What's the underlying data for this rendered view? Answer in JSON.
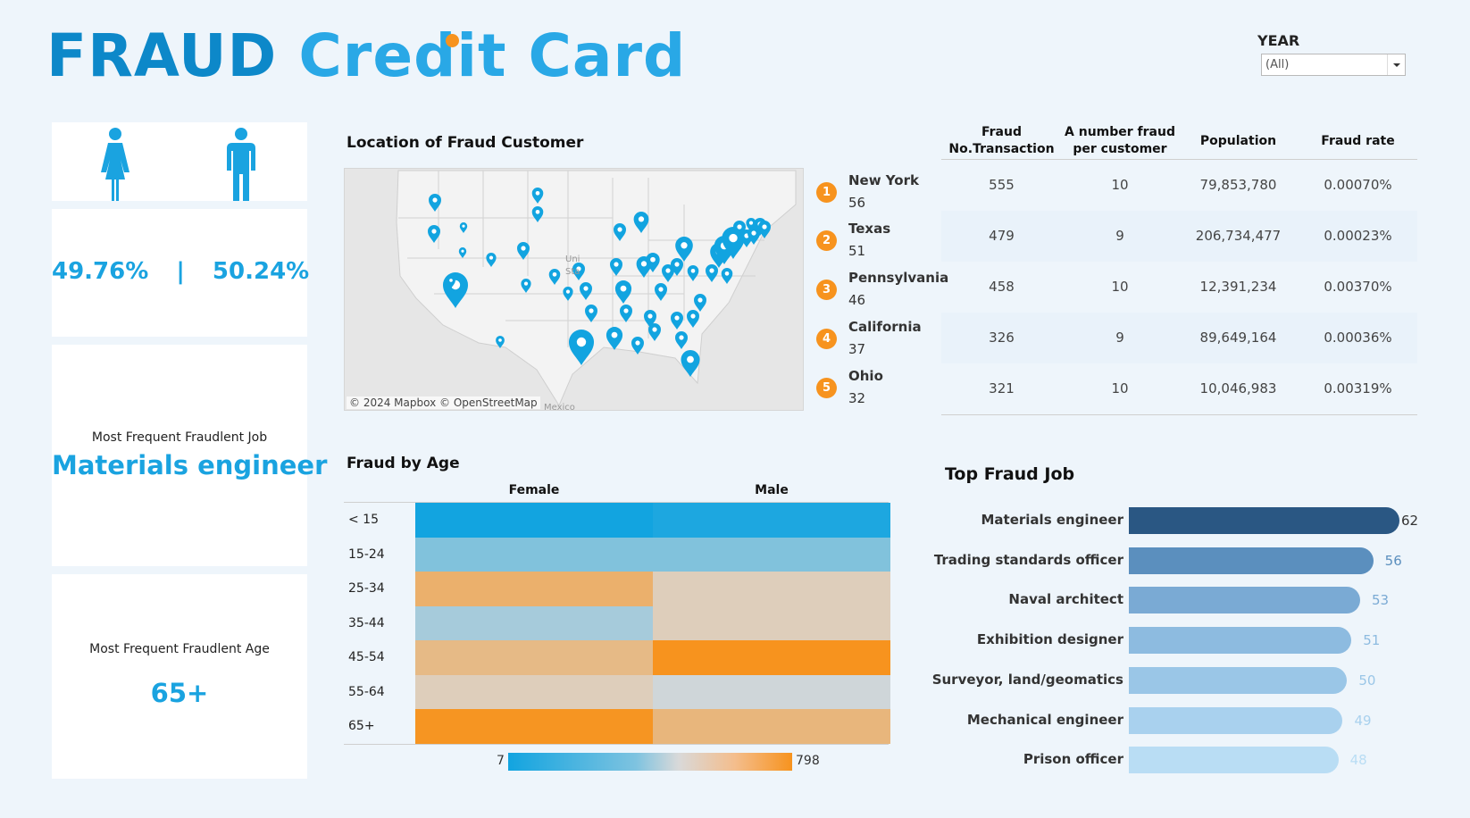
{
  "title": {
    "part1": "FRAUD",
    "part2": "Credit Card"
  },
  "year_filter": {
    "label": "YEAR",
    "value": "(All)"
  },
  "gender": {
    "female_icon": "female-icon",
    "male_icon": "male-icon",
    "female_pct": "49.76%",
    "separator": "|",
    "male_pct": "50.24%"
  },
  "job_kpi": {
    "label": "Most Frequent  Fraudlent Job",
    "value": "Materials engineer"
  },
  "age_kpi": {
    "label": "Most Frequent  Fraudlent Age",
    "value": "65+"
  },
  "map": {
    "title": "Location of Fraud Customer",
    "credit": "© 2024 Mapbox © OpenStreetMap",
    "labels": [
      "Uni",
      "Sta",
      "Mexico"
    ]
  },
  "top_states": [
    {
      "rank": "1",
      "state": "New York",
      "count": "56"
    },
    {
      "rank": "2",
      "state": "Texas",
      "count": "51"
    },
    {
      "rank": "3",
      "state": "Pennsylvania",
      "count": "46"
    },
    {
      "rank": "4",
      "state": "California",
      "count": "37"
    },
    {
      "rank": "5",
      "state": "Ohio",
      "count": "32"
    }
  ],
  "state_table": {
    "headers": {
      "transactions": [
        "Fraud",
        "No.Transaction"
      ],
      "per_customer": [
        "A number fraud",
        "per customer"
      ],
      "population": "Population",
      "rate": "Fraud rate"
    },
    "rows": [
      {
        "transactions": "555",
        "per_customer": "10",
        "population": "79,853,780",
        "rate": "0.00070%"
      },
      {
        "transactions": "479",
        "per_customer": "9",
        "population": "206,734,477",
        "rate": "0.00023%"
      },
      {
        "transactions": "458",
        "per_customer": "10",
        "population": "12,391,234",
        "rate": "0.00370%"
      },
      {
        "transactions": "326",
        "per_customer": "9",
        "population": "89,649,164",
        "rate": "0.00036%"
      },
      {
        "transactions": "321",
        "per_customer": "10",
        "population": "10,046,983",
        "rate": "0.00319%"
      }
    ]
  },
  "chart_data": [
    {
      "type": "heatmap",
      "title": "Fraud by Age",
      "columns": [
        "Female",
        "Male"
      ],
      "rows": [
        "< 15",
        "15-24",
        "25-34",
        "35-44",
        "45-54",
        "55-64",
        "65+"
      ],
      "values": [
        [
          7,
          30
        ],
        [
          250,
          250
        ],
        [
          650,
          500
        ],
        [
          330,
          500
        ],
        [
          600,
          798
        ],
        [
          500,
          420
        ],
        [
          790,
          620
        ]
      ],
      "color_range": [
        7,
        798
      ],
      "legend_min": "7",
      "legend_max": "798",
      "colors": {
        "low": "#12a4e0",
        "mid": "#d9d9d9",
        "high": "#f7931e"
      }
    },
    {
      "type": "bar",
      "title": "Top Fraud Job",
      "orientation": "horizontal",
      "categories": [
        "Materials engineer",
        "Trading standards officer",
        "Naval architect",
        "Exhibition designer",
        "Surveyor, land/geomatics",
        "Mechanical engineer",
        "Prison officer"
      ],
      "values": [
        62,
        56,
        53,
        51,
        50,
        49,
        48
      ],
      "colors": [
        "#2a5783",
        "#5b8fbe",
        "#7aaad4",
        "#8dbbe0",
        "#9ac6e7",
        "#a9d1ee",
        "#b9ddf4"
      ],
      "value_colors": [
        "#333333",
        "#5b8fbe",
        "#7aaad4",
        "#8dbbe0",
        "#9ac6e7",
        "#a9d1ee",
        "#b9ddf4"
      ]
    }
  ]
}
